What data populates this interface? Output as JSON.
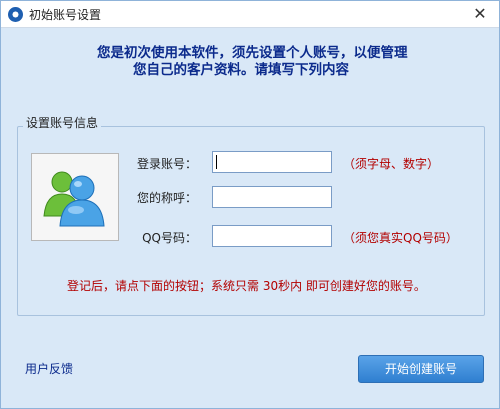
{
  "window": {
    "title": "初始账号设置",
    "close_glyph": "✕"
  },
  "intro": {
    "line1": "您是初次使用本软件，须先设置个人账号，以便管理",
    "line2": "您自己的客户资料。请填写下列内容"
  },
  "group": {
    "title": "设置账号信息"
  },
  "avatar": {
    "icon": "users-icon"
  },
  "fields": [
    {
      "label": "登录账号：",
      "value": "",
      "hint": "（须字母、数字）"
    },
    {
      "label": "您的称呼：",
      "value": "",
      "hint": ""
    },
    {
      "label": "QQ号码：",
      "value": "",
      "hint": "（须您真实QQ号码）"
    }
  ],
  "notice": "登记后，请点下面的按钮；系统只需 30秒内 即可创建好您的账号。",
  "footer": {
    "feedback_label": "用户反馈",
    "create_button_label": "开始创建账号"
  },
  "colors": {
    "window_bg": "#d9e8f7",
    "intro_text": "#0b2a8c",
    "hint_text": "#b30000",
    "button_bg": "#3a8ad8"
  }
}
